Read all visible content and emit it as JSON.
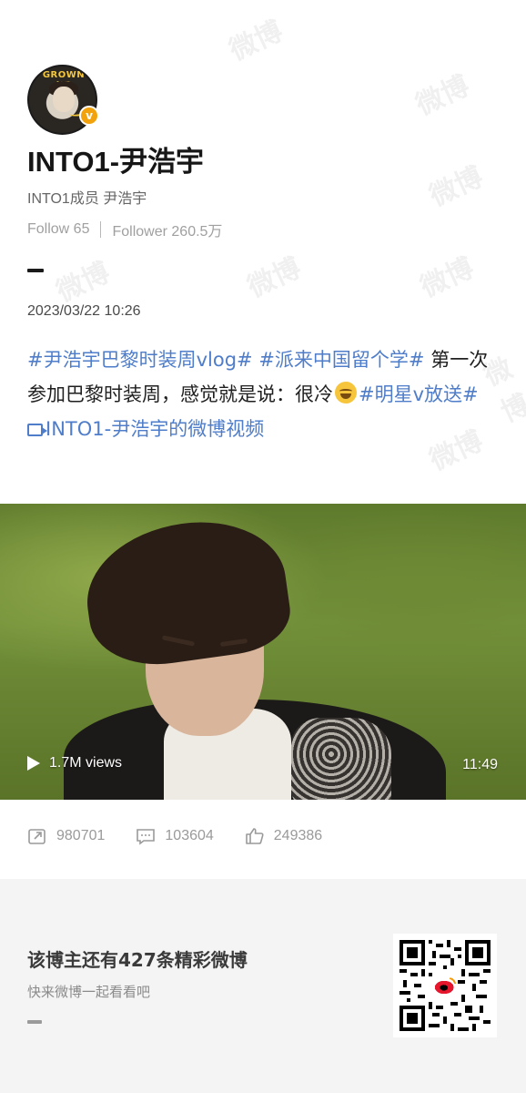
{
  "profile": {
    "avatar_text": "GROWN UP",
    "verified_icon": "verified-v-icon",
    "name": "INTO1-尹浩宇",
    "bio": "INTO1成员 尹浩宇",
    "follow_label": "Follow 65",
    "follower_label": "Follower 260.5万"
  },
  "post": {
    "date": "2023/03/22 10:26",
    "tag1": "#尹浩宇巴黎时装周vlog#",
    "tag2": "#派来中国留个学#",
    "text1": "第一次参加巴黎时装周，感觉就是说：很冷",
    "tag3": "#明星v放送#",
    "video_link": "INTO1-尹浩宇的微博视频"
  },
  "video": {
    "views": "1.7M views",
    "duration": "11:49"
  },
  "actions": {
    "reposts": "980701",
    "comments": "103604",
    "likes": "249386"
  },
  "footer": {
    "title": "该博主还有427条精彩微博",
    "subtitle": "快来微博一起看看吧"
  },
  "colors": {
    "link": "#4f7dc9",
    "verified": "#f2a20c",
    "footer_bg": "#f4f4f4"
  }
}
